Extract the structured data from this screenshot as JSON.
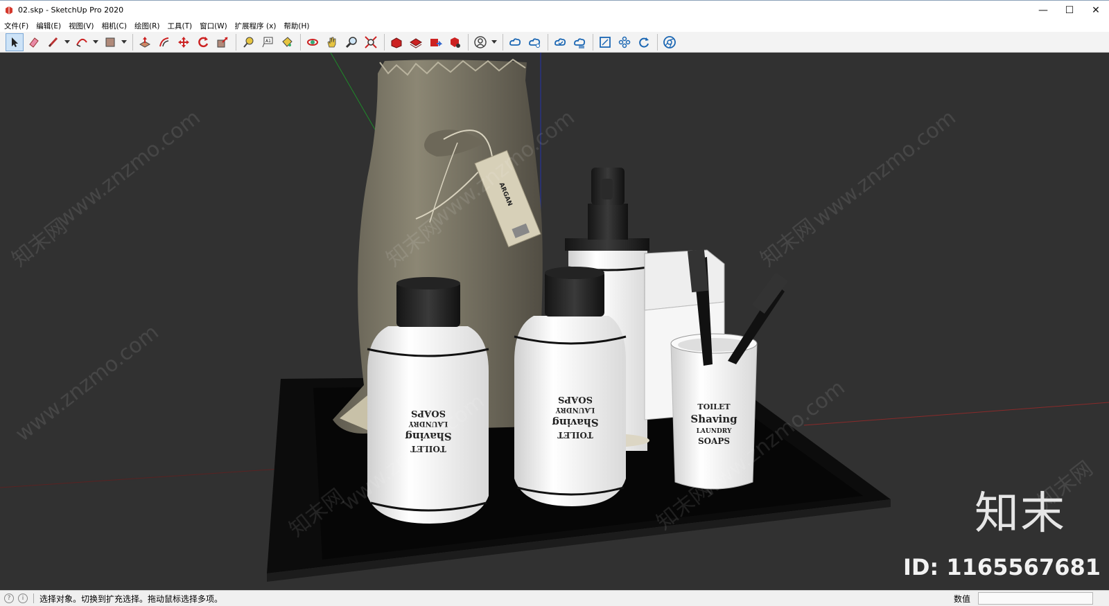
{
  "window": {
    "title": "02.skp - SketchUp Pro 2020",
    "controls": {
      "minimize": "—",
      "maximize": "☐",
      "close": "✕"
    }
  },
  "menu": [
    "文件(F)",
    "编辑(E)",
    "视图(V)",
    "相机(C)",
    "绘图(R)",
    "工具(T)",
    "窗口(W)",
    "扩展程序 (x)",
    "帮助(H)"
  ],
  "toolbar": {
    "icons": [
      "select-icon",
      "eraser-icon",
      "line-icon",
      "arc-icon",
      "rectangle-icon",
      "push-pull-icon",
      "offset-icon",
      "move-icon",
      "rotate-icon",
      "scale-icon",
      "tape-measure-icon",
      "text-icon",
      "paint-bucket-icon",
      "orbit-icon",
      "pan-icon",
      "zoom-icon",
      "zoom-extents-icon",
      "warehouse-icon",
      "extension-warehouse-icon",
      "send-to-layout-icon",
      "extension-manager-icon",
      "account-icon",
      "trimble-connect-icon",
      "cloud-upload-icon",
      "cloud-sync-icon",
      "cloud-share-icon",
      "layout-icon",
      "components-icon",
      "refresh-icon",
      "chrome-icon"
    ]
  },
  "scene": {
    "bag_tag_text": "ARGAN",
    "bottle_label_lines": [
      "TOILET",
      "Shaving",
      "LAUNDRY",
      "SOAPS"
    ]
  },
  "watermarks": {
    "site": "www.znzmo.com",
    "cn": "知末网"
  },
  "branding": {
    "logo": "知末",
    "id_text": "ID: 1165567681"
  },
  "statusbar": {
    "hint": "选择对象。切换到扩充选择。拖动鼠标选择多项。",
    "measurements_label": "数值",
    "measurements_value": ""
  }
}
